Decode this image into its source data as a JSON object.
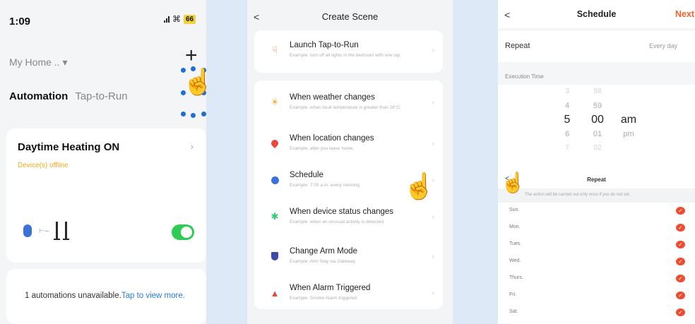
{
  "screen1": {
    "time": "1:09",
    "battery": "66",
    "home_label": "My Home .. ▾",
    "add_icon": "+",
    "tabs": {
      "automation": "Automation",
      "tap_to_run": "Tap-to-Run"
    },
    "automation_card": {
      "title": "Daytime Heating ON",
      "status": "Device(s) offline",
      "enabled": true
    },
    "unavailable": {
      "text": "1 automations unavailable.",
      "link": "Tap to view more."
    }
  },
  "screen2": {
    "back": "<",
    "title": "Create Scene",
    "items": [
      {
        "label": "Launch Tap-to-Run",
        "desc": "Example: turn off all lights in the bedroom with one tap.",
        "icon": "hand-tap-icon",
        "color": "#f0642c"
      },
      {
        "label": "When weather changes",
        "desc": "Example: when local temperature is greater than 28°C.",
        "icon": "sun-icon",
        "color": "#f5a623"
      },
      {
        "label": "When location changes",
        "desc": "Example: after you leave home.",
        "icon": "location-pin-icon",
        "color": "#e8493a"
      },
      {
        "label": "Schedule",
        "desc": "Example: 7:00 a.m. every morning.",
        "icon": "clock-icon",
        "color": "#3b72d8"
      },
      {
        "label": "When device status changes",
        "desc": "Example: when an unusual activity is detected.",
        "icon": "device-icon",
        "color": "#2ecc71"
      },
      {
        "label": "Change Arm Mode",
        "desc": "Example: Arm Stay via Gateway.",
        "icon": "shield-icon",
        "color": "#3f4aa8"
      },
      {
        "label": "When Alarm Triggered",
        "desc": "Example: Smoke Alarm triggered.",
        "icon": "alarm-icon",
        "color": "#e8493a"
      }
    ]
  },
  "screen3": {
    "back": "<",
    "title": "Schedule",
    "next": "Next",
    "repeat_label": "Repeat",
    "repeat_value": "Every day",
    "execution_time_label": "Execution Time",
    "picker": {
      "hours": [
        "3",
        "4",
        "5",
        "6",
        "7"
      ],
      "minutes": [
        "58",
        "59",
        "00",
        "01",
        "02"
      ],
      "periods": [
        "am",
        "pm"
      ]
    },
    "repeat_sheet": {
      "back": "<",
      "title": "Repeat",
      "note": "The action will be carried out only once if you do not set.",
      "days": [
        "Sun.",
        "Mon.",
        "Tues.",
        "Wed.",
        "Thurs.",
        "Fri.",
        "Sat."
      ]
    }
  }
}
